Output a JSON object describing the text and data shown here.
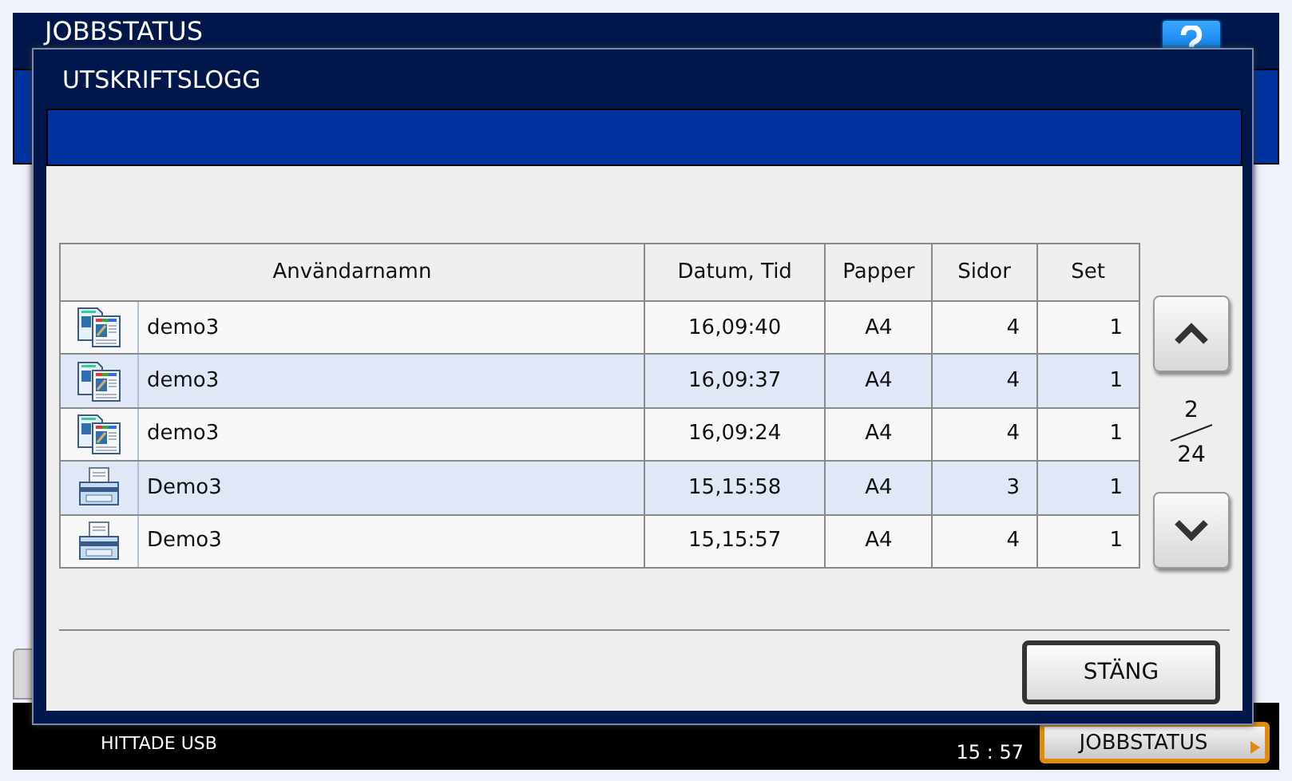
{
  "screen": {
    "title": "JOBBSTATUS",
    "status_message": "HITTADE USB",
    "time": "15 : 57",
    "job_status_button": "JOBBSTATUS"
  },
  "dialog": {
    "title": "UTSKRIFTSLOGG",
    "table": {
      "columns": [
        "Användarnamn",
        "Datum, Tid",
        "Papper",
        "Sidor",
        "Set"
      ],
      "rows": [
        {
          "kind": "documents",
          "user": "demo3",
          "datetime": "16,09:40",
          "paper": "A4",
          "pages": "4",
          "sets": "1"
        },
        {
          "kind": "documents",
          "user": "demo3",
          "datetime": "16,09:37",
          "paper": "A4",
          "pages": "4",
          "sets": "1"
        },
        {
          "kind": "documents",
          "user": "demo3",
          "datetime": "16,09:24",
          "paper": "A4",
          "pages": "4",
          "sets": "1"
        },
        {
          "kind": "printer",
          "user": "Demo3",
          "datetime": "15,15:58",
          "paper": "A4",
          "pages": "3",
          "sets": "1"
        },
        {
          "kind": "printer",
          "user": "Demo3",
          "datetime": "15,15:57",
          "paper": "A4",
          "pages": "4",
          "sets": "1"
        }
      ]
    },
    "pager": {
      "current": "2",
      "total": "24"
    },
    "close_button": "STÄNG"
  }
}
